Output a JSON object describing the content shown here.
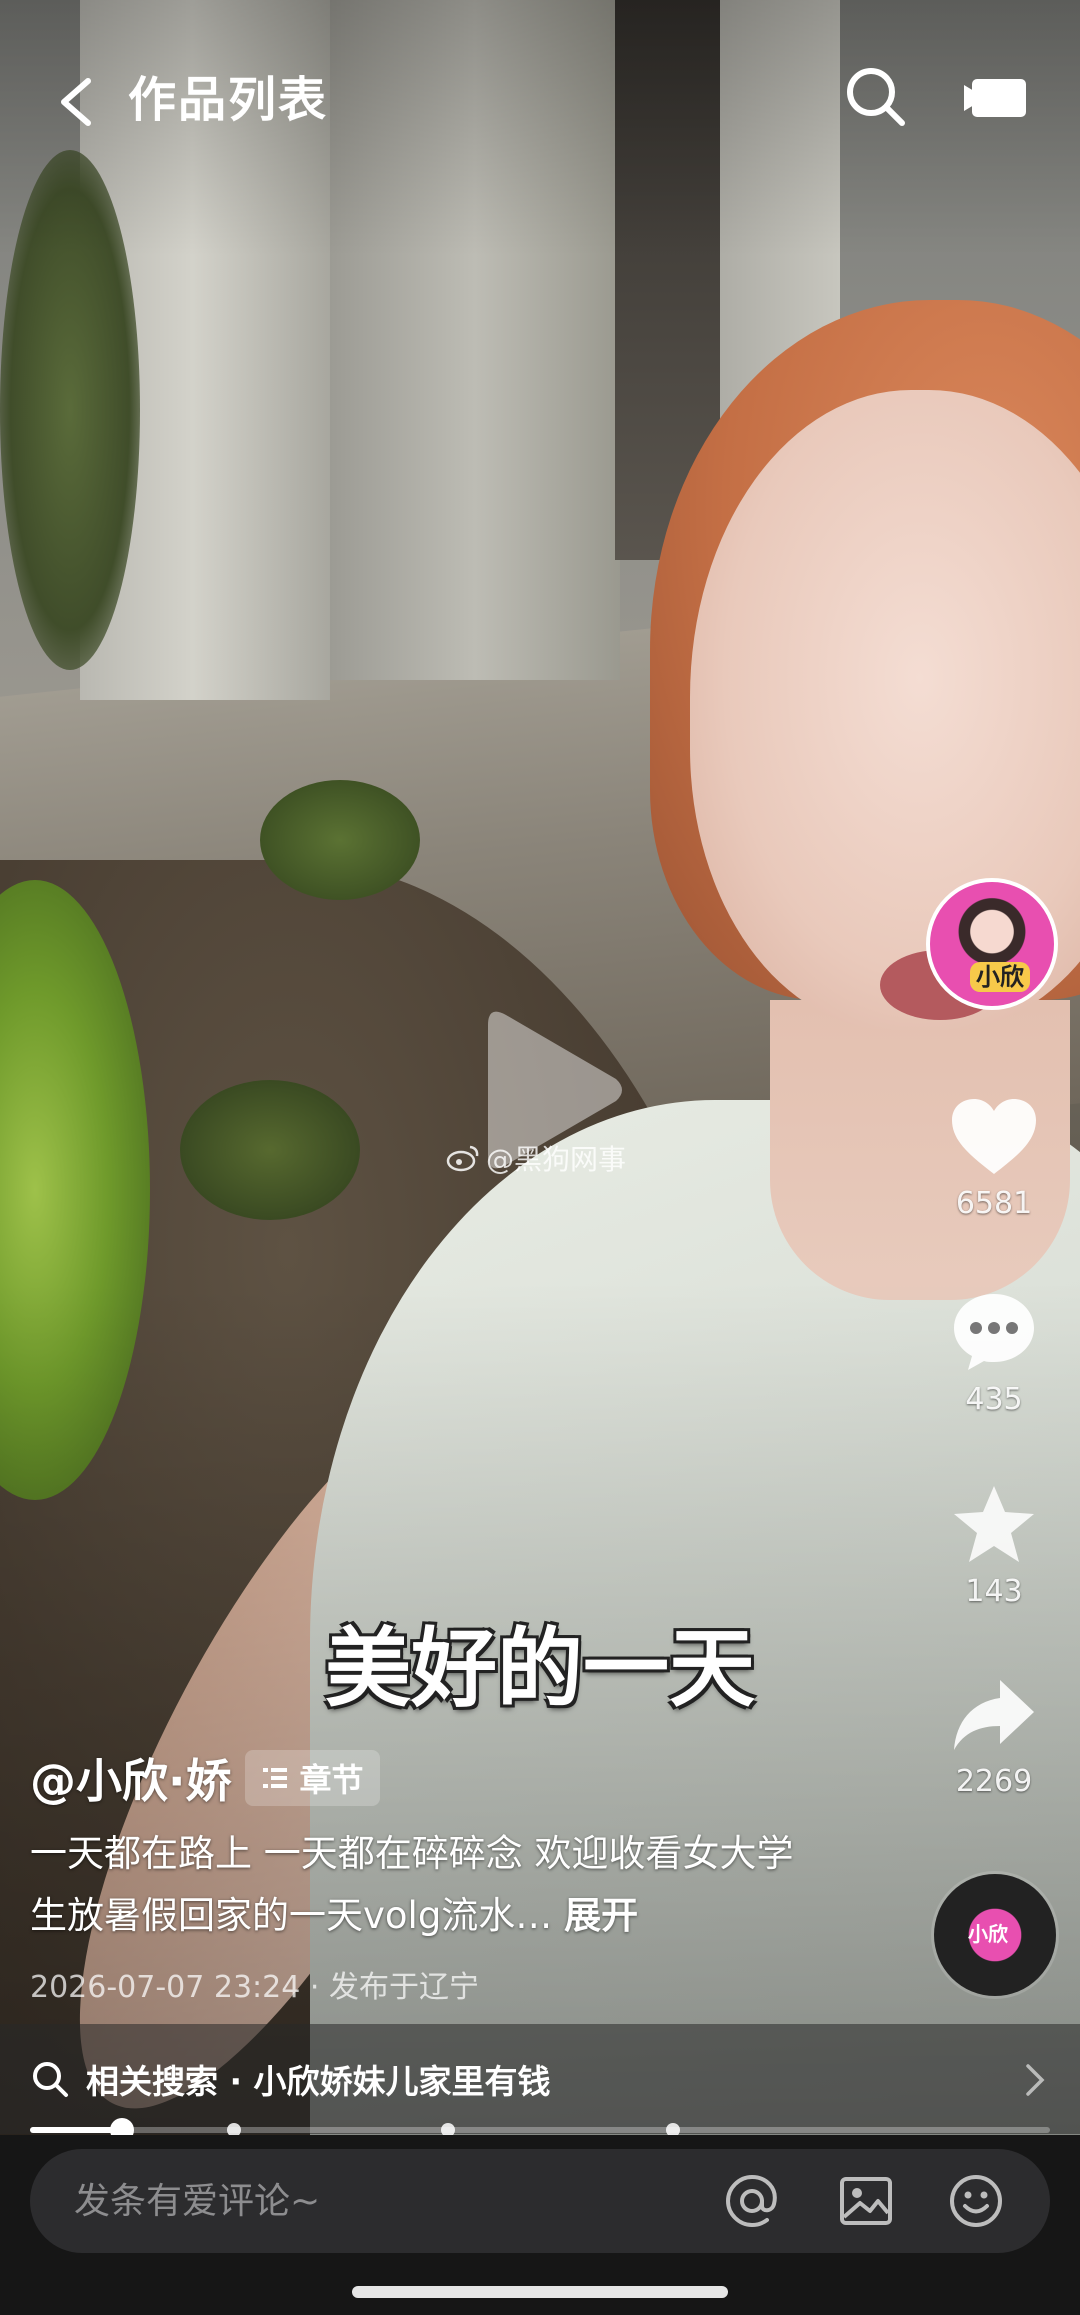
{
  "header": {
    "title": "作品列表",
    "back_icon": "chevron-left-icon",
    "search_icon": "search-icon",
    "video_icon": "video-camera-icon"
  },
  "video": {
    "caption": "美好的一天",
    "watermark": "@黑狗网事",
    "progress": 0.09,
    "chapter_markers": [
      0.2,
      0.41,
      0.63
    ]
  },
  "rail": {
    "avatar_label": "小欣",
    "likes": "6581",
    "comments": "435",
    "favorites": "143",
    "shares": "2269",
    "music_label": "小欣"
  },
  "post": {
    "author": "@小欣·娇",
    "chapter_label": "章节",
    "description": "一天都在路上 一天都在碎碎念 欢迎收看女大学生放暑假回家的一天volg流水…",
    "expand_label": "展开",
    "datetime": "2026-07-07 23:24",
    "location": "发布于辽宁"
  },
  "related": {
    "label": "相关搜索",
    "query": "小欣娇妹儿家里有钱"
  },
  "comment_bar": {
    "placeholder": "发条有爱评论~"
  },
  "colors": {
    "comment_bar_bg": "#2c2c2e",
    "bottom_bg": "#161616",
    "avatar_ring": "#e84fb0"
  }
}
